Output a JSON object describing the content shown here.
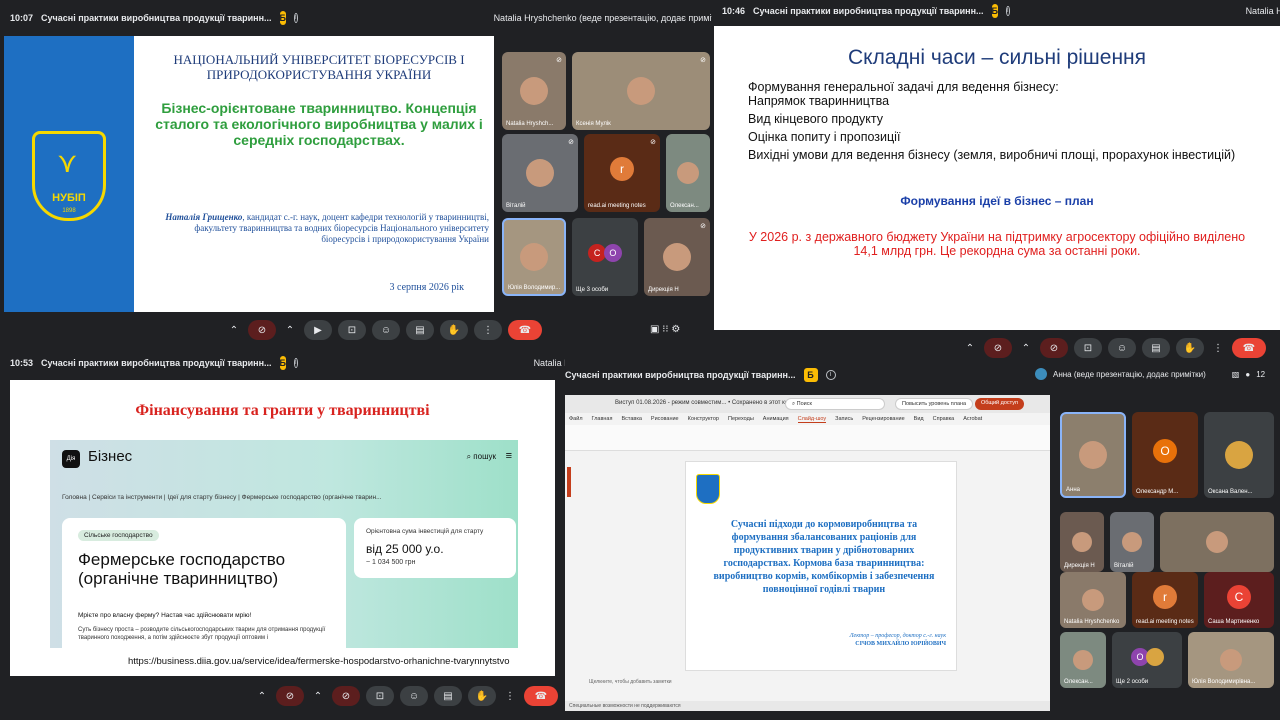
{
  "q1": {
    "time": "10:07",
    "title": "Сучасні практики виробництва продукції тваринн...",
    "presenter": "Natalia Hryshchenko (веде презентацію, додає примітки)",
    "participants_count": "11",
    "slide": {
      "university": "НАЦІОНАЛЬНИЙ УНІВЕРСИТЕТ БІОРЕСУРСІВ І ПРИРОДОКОРИСТУВАННЯ УКРАЇНИ",
      "logo_text": "НУБІП",
      "logo_year": "1898",
      "topic": "Бізнес-орієнтоване тваринництво. Концепція сталого та екологічного виробництва у малих і середніх господарствах.",
      "author_name": "Наталія Грищенко",
      "author_info": ", кандидат с.-г. наук, доцент кафедри технологій у тваринництві, факультету тваринництва та водних біоресурсів Національного університету біоресурсів і природокористування України",
      "date": "3 серпня 2026 рік"
    },
    "tiles": [
      {
        "name": "Natalia Hryshch..."
      },
      {
        "name": "Ксенія Мулік"
      },
      {
        "name": "Віталій"
      },
      {
        "name": "read.ai meeting notes",
        "letter": "r"
      },
      {
        "name": "Олексан..."
      },
      {
        "name": "Юлія Володимир..."
      },
      {
        "name": "Ще 3 особи"
      },
      {
        "name": "Дирекція Н"
      }
    ]
  },
  "q2": {
    "time": "10:46",
    "title": "Сучасні практики виробництва продукції тваринн...",
    "presenter": "Natalia Hryshc",
    "slide": {
      "heading": "Складні часи – сильні рішення",
      "items": [
        "Формування генеральної задачі для ведення бізнесу: Напрямок тваринництва",
        "Вид кінцевого продукту",
        "Оцінка попиту і пропозиції",
        "Вихідні умови для ведення бізнесу (земля, виробничі площі, прорахунок інвестицій)"
      ],
      "subheading": "Формування ідеї в бізнес – план",
      "red_text": "У 2026 р. з державного бюджету України на підтримку агросектору офіційно виділено 14,1 млрд грн. Це рекордна сума за останні роки."
    }
  },
  "q3": {
    "time": "10:53",
    "title": "Сучасні практики виробництва продукції тваринн...",
    "presenter": "Natalia Hry",
    "slide": {
      "heading": "Фінансування та гранти у тваринництві",
      "diia_logo": "Дія",
      "diia_section": "Бізнес",
      "search_label": "пошук",
      "breadcrumb": "Головна | Сервіси та інструменти | Ідеї для старту бізнесу | Фермерське господарство (органічне тварин...",
      "chip": "Сільське господарство",
      "card_title": "Фермерське господарство (органічне тваринництво)",
      "card_question": "Мрієте про власну ферму? Настав час здійснювати мрію!",
      "card_text": "Суть бізнесу проста – розводите сільськогосподарських тварин для отримання продукції тваринного походження, а потім здійснюєте збут продукції оптовим і",
      "invest_label": "Орієнтовна сума інвестицій для старту",
      "invest_value": "від 25 000 у.о.",
      "invest_uah": "~ 1 034 500 грн",
      "url": "https://business.diia.gov.ua/service/idea/fermerske-hospodarstvo-orhanichne-tvarynnytstvo"
    }
  },
  "q4": {
    "title": "Сучасні практики виробництва продукції тваринн...",
    "presenter": "Анна (веде презентацію, додає примітки)",
    "participants_count": "12",
    "ppt": {
      "file": "Виступ 01.08.2026 - режим совместим... • Сохранено в этот компьютер",
      "search": "Поиск",
      "promo": "Повысить уровень плана",
      "share": "Общий доступ",
      "tabs": [
        "Файл",
        "Главная",
        "Вставка",
        "Рисование",
        "Конструктор",
        "Переходы",
        "Анимация",
        "Слайд-шоу",
        "Запись",
        "Рецензирование",
        "Вид",
        "Справка",
        "Acrobat"
      ],
      "active_tab": "Слайд-шоу",
      "slide_text": "Сучасні підходи до кормовиробництва та формування збалансованих раціонів для продуктивних тварин у дрібнотоварних господарствах. Кормова база тваринництва: виробництво кормів, комбікормів і забезпечення повноцінної годівлі тварин",
      "lecturer": "Лектор – професор, доктор с.-г. наук",
      "lecturer_name": "СІЧОВ МИХАЙЛО ЮРІЙОВИЧ",
      "notes": "Щелкните, чтобы добавить заметки",
      "status": "Специальные возможности не поддерживаются"
    },
    "tiles": [
      {
        "name": "Анна"
      },
      {
        "name": "Олександр М...",
        "letter": "О"
      },
      {
        "name": "Оксана Вален..."
      },
      {
        "name": "Дирекція Н"
      },
      {
        "name": "Віталій"
      },
      {
        "name": ""
      },
      {
        "name": "Natalia Hryshchenko"
      },
      {
        "name": "read.ai meeting notes",
        "letter": "r"
      },
      {
        "name": "Саша Мартиненко",
        "letter": "С"
      },
      {
        "name": "Олексан..."
      },
      {
        "name": "Ще 2 особи"
      },
      {
        "name": "Юлія Володимирівна..."
      }
    ]
  },
  "colors": {
    "meet_bg": "#202124",
    "end_call": "#ea4335",
    "accent_blue": "#1e6fc2"
  }
}
